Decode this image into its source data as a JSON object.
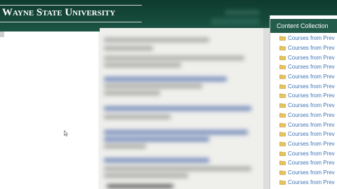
{
  "header": {
    "brand": "Wayne State University"
  },
  "content_collection": {
    "title": "Content Collection",
    "folder_icon": "folder-icon",
    "items": [
      "Courses from Prev",
      "Courses from Prev",
      "Courses from Prev",
      "Courses from Prev",
      "Courses from Prev",
      "Courses from Prev",
      "Courses from Prev",
      "Courses from Prev",
      "Courses from Prev",
      "Courses from Prev",
      "Courses from Prev",
      "Courses from Prev",
      "Courses from Prev",
      "Courses from Prev",
      "Courses from Prev",
      "Courses from Prev"
    ]
  },
  "colors": {
    "header_green": "#15493a",
    "panel_header_green": "#245c4b",
    "link_blue": "#3f73b3",
    "folder_yellow": "#e8c45a"
  }
}
